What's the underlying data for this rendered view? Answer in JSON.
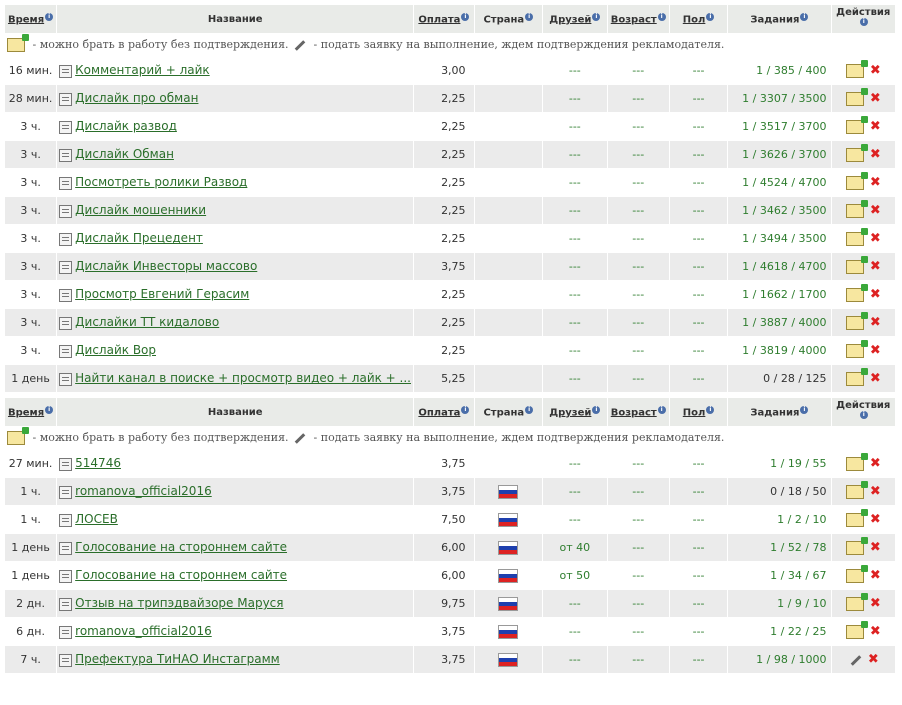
{
  "headers": {
    "time": "Время",
    "name": "Название",
    "pay": "Оплата",
    "country": "Страна",
    "friends": "Друзей",
    "age": "Возраст",
    "gender": "Пол",
    "tasks": "Задания",
    "actions": "Действия"
  },
  "legend": {
    "no_confirm": " - можно брать в работу без подтверждения.",
    "with_confirm": " - подать заявку на выполнение, ждем подтверждения рекламодателя."
  },
  "dash": "---",
  "table1": {
    "rows": [
      {
        "time": "16 мин.",
        "name": "Комментарий + лайк",
        "pay": "3,00",
        "flag": false,
        "friends": "---",
        "age": "---",
        "gender": "---",
        "tasks": "1 / 385 / 400",
        "action": "take"
      },
      {
        "time": "28 мин.",
        "name": "Дислайк про обман",
        "pay": "2,25",
        "flag": false,
        "friends": "---",
        "age": "---",
        "gender": "---",
        "tasks": "1 / 3307 / 3500",
        "action": "take"
      },
      {
        "time": "3 ч.",
        "name": "Дислайк развод",
        "pay": "2,25",
        "flag": false,
        "friends": "---",
        "age": "---",
        "gender": "---",
        "tasks": "1 / 3517 / 3700",
        "action": "take"
      },
      {
        "time": "3 ч.",
        "name": "Дислайк Обман",
        "pay": "2,25",
        "flag": false,
        "friends": "---",
        "age": "---",
        "gender": "---",
        "tasks": "1 / 3626 / 3700",
        "action": "take"
      },
      {
        "time": "3 ч.",
        "name": "Посмотреть ролики Развод",
        "pay": "2,25",
        "flag": false,
        "friends": "---",
        "age": "---",
        "gender": "---",
        "tasks": "1 / 4524 / 4700",
        "action": "take"
      },
      {
        "time": "3 ч.",
        "name": "Дислайк мошенники",
        "pay": "2,25",
        "flag": false,
        "friends": "---",
        "age": "---",
        "gender": "---",
        "tasks": "1 / 3462 / 3500",
        "action": "take"
      },
      {
        "time": "3 ч.",
        "name": "Дислайк Прецедент",
        "pay": "2,25",
        "flag": false,
        "friends": "---",
        "age": "---",
        "gender": "---",
        "tasks": "1 / 3494 / 3500",
        "action": "take"
      },
      {
        "time": "3 ч.",
        "name": "Дислайк Инвесторы массово",
        "pay": "3,75",
        "flag": false,
        "friends": "---",
        "age": "---",
        "gender": "---",
        "tasks": "1 / 4618 / 4700",
        "action": "take"
      },
      {
        "time": "3 ч.",
        "name": "Просмотр Евгений Герасим",
        "pay": "2,25",
        "flag": false,
        "friends": "---",
        "age": "---",
        "gender": "---",
        "tasks": "1 / 1662 / 1700",
        "action": "take"
      },
      {
        "time": "3 ч.",
        "name": "Дислайки ТТ кидалово",
        "pay": "2,25",
        "flag": false,
        "friends": "---",
        "age": "---",
        "gender": "---",
        "tasks": "1 / 3887 / 4000",
        "action": "take"
      },
      {
        "time": "3 ч.",
        "name": "Дислайк Вор",
        "pay": "2,25",
        "flag": false,
        "friends": "---",
        "age": "---",
        "gender": "---",
        "tasks": "1 / 3819 / 4000",
        "action": "take"
      },
      {
        "time": "1 день",
        "name": "Найти канал в поиске + просмотр видео + лайк + ...",
        "pay": "5,25",
        "flag": false,
        "friends": "---",
        "age": "---",
        "gender": "---",
        "tasks": "0 / 28 / 125",
        "action": "take"
      }
    ]
  },
  "table2": {
    "rows": [
      {
        "time": "27 мин.",
        "name": "514746",
        "pay": "3,75",
        "flag": false,
        "friends": "---",
        "age": "---",
        "gender": "---",
        "tasks": "1 / 19 / 55",
        "action": "take"
      },
      {
        "time": "1 ч.",
        "name": "romanova_official2016",
        "pay": "3,75",
        "flag": true,
        "friends": "---",
        "age": "---",
        "gender": "---",
        "tasks": "0 / 18 / 50",
        "action": "take"
      },
      {
        "time": "1 ч.",
        "name": "ЛОСЕВ",
        "pay": "7,50",
        "flag": true,
        "friends": "---",
        "age": "---",
        "gender": "---",
        "tasks": "1 / 2 / 10",
        "action": "take"
      },
      {
        "time": "1 день",
        "name": "Голосование на стороннем сайте",
        "pay": "6,00",
        "flag": true,
        "friends": "от 40",
        "age": "---",
        "gender": "---",
        "tasks": "1 / 52 / 78",
        "action": "take"
      },
      {
        "time": "1 день",
        "name": "Голосование на стороннем сайте",
        "pay": "6,00",
        "flag": true,
        "friends": "от 50",
        "age": "---",
        "gender": "---",
        "tasks": "1 / 34 / 67",
        "action": "take"
      },
      {
        "time": "2 дн.",
        "name": "Отзыв на трипэдвайзоре Маруся",
        "pay": "9,75",
        "flag": true,
        "friends": "---",
        "age": "---",
        "gender": "---",
        "tasks": "1 / 9 / 10",
        "action": "take"
      },
      {
        "time": "6 дн.",
        "name": "romanova_official2016",
        "pay": "3,75",
        "flag": true,
        "friends": "---",
        "age": "---",
        "gender": "---",
        "tasks": "1 / 22 / 25",
        "action": "take"
      },
      {
        "time": "7 ч.",
        "name": "Префектура ТиНАО Инстаграмм",
        "pay": "3,75",
        "flag": true,
        "friends": "---",
        "age": "---",
        "gender": "---",
        "tasks": "1 / 98 / 1000",
        "action": "apply"
      }
    ]
  }
}
